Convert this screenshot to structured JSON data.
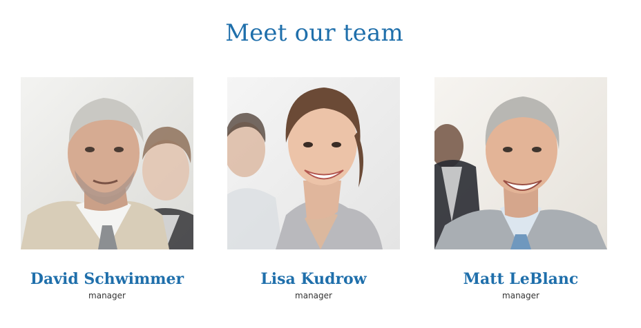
{
  "page": {
    "title": "Meet our team"
  },
  "colors": {
    "accent": "#1f6fab",
    "text": "#333333",
    "background": "#ffffff"
  },
  "team": [
    {
      "name": "David Schwimmer",
      "role": "manager",
      "photo": "man-gray-hair-beard-photo"
    },
    {
      "name": "Lisa Kudrow",
      "role": "manager",
      "photo": "woman-smiling-photo"
    },
    {
      "name": "Matt LeBlanc",
      "role": "manager",
      "photo": "man-gray-hair-smiling-photo"
    }
  ]
}
